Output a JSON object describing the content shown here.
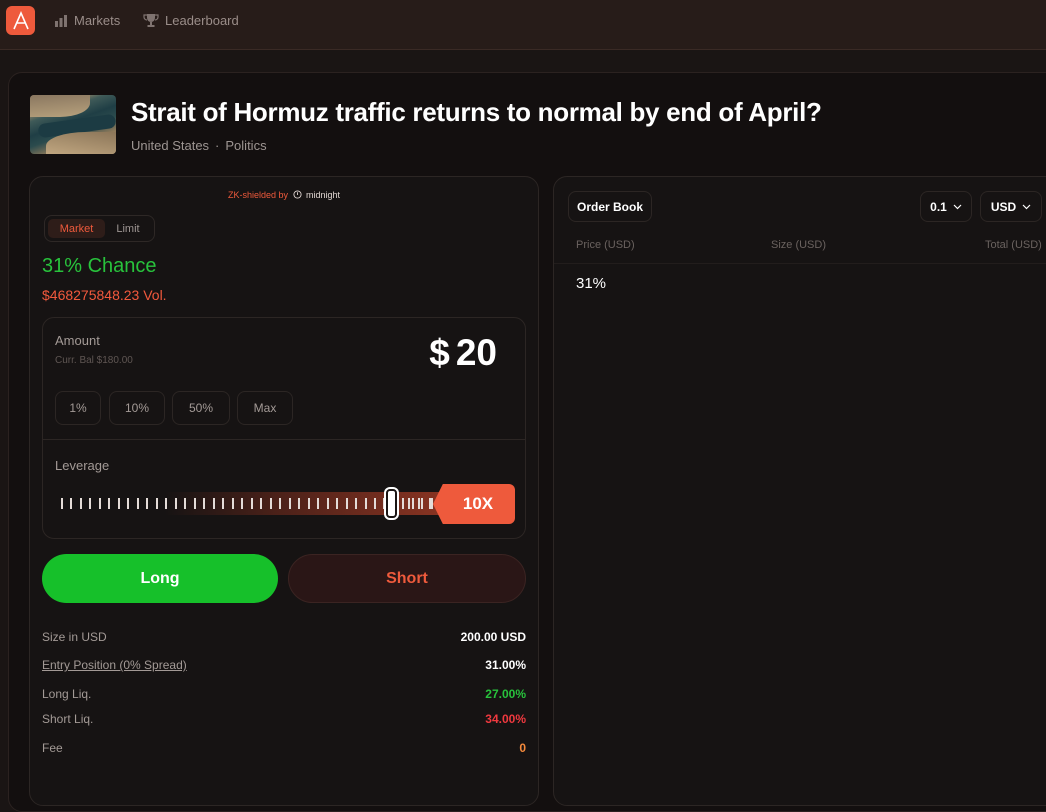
{
  "nav": {
    "markets_label": "Markets",
    "leaderboard_label": "Leaderboard"
  },
  "market": {
    "title": "Strait of Hormuz traffic returns to normal by end of April?",
    "country": "United States",
    "separator": "·",
    "category": "Politics"
  },
  "trade": {
    "zk_prefix": "ZK-shielded by",
    "zk_brand": "midnight",
    "tabs": [
      "Market",
      "Limit"
    ],
    "chance": "31% Chance",
    "volume": "$468275848.23 Vol.",
    "amount_label": "Amount",
    "balance_label": "Curr. Bal $180.00",
    "currency_symbol": "$",
    "amount_value": "20",
    "percent_buttons": [
      "1%",
      "10%",
      "50%",
      "Max"
    ],
    "leverage_label": "Leverage",
    "leverage_value": "10X",
    "leverage_fraction": 0.8,
    "long_label": "Long",
    "short_label": "Short",
    "details": [
      {
        "label": "Size in USD",
        "value": "200.00 USD"
      },
      {
        "label": "Entry Position (0% Spread)",
        "value": "31.00%"
      },
      {
        "label": "Long Liq.",
        "value": "27.00%"
      },
      {
        "label": "Short Liq.",
        "value": "34.00%"
      },
      {
        "label": "Fee",
        "value": "0"
      }
    ]
  },
  "orderbook": {
    "title": "Order Book",
    "step": "0.1",
    "currency": "USD",
    "columns": [
      "Price (USD)",
      "Size (USD)",
      "Total (USD)"
    ],
    "price": "31%"
  },
  "colors": {
    "accent": "#ee5a3c",
    "long": "#16c02a",
    "green_text": "#28c23c",
    "red_text": "#f0393f",
    "fee_text": "#f58a3c"
  }
}
